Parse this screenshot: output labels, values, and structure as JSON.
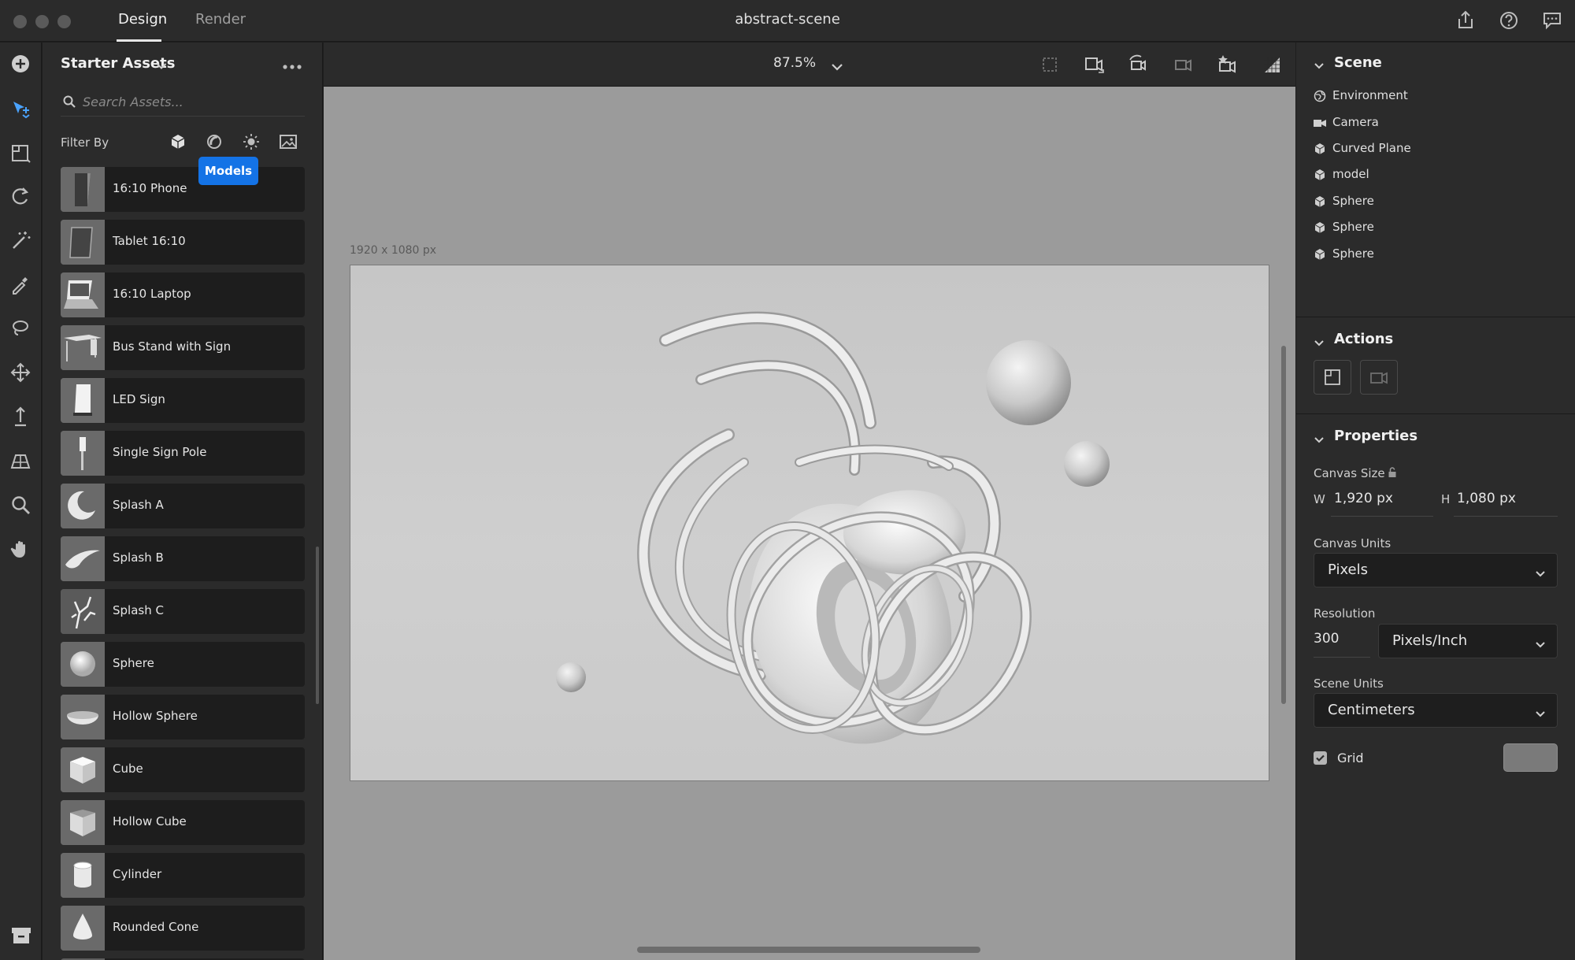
{
  "titlebar": {
    "tabs": [
      {
        "label": "Design"
      },
      {
        "label": "Render"
      }
    ],
    "document_title": "abstract-scene"
  },
  "assets": {
    "title": "Starter Assets",
    "search_placeholder": "Search Assets...",
    "filter_label": "Filter By",
    "tooltip": "Models",
    "items": [
      {
        "label": "16:10 Phone"
      },
      {
        "label": "Tablet 16:10"
      },
      {
        "label": "16:10 Laptop"
      },
      {
        "label": "Bus Stand with Sign"
      },
      {
        "label": "LED Sign"
      },
      {
        "label": "Single Sign Pole"
      },
      {
        "label": "Splash A"
      },
      {
        "label": "Splash B"
      },
      {
        "label": "Splash C"
      },
      {
        "label": "Sphere"
      },
      {
        "label": "Hollow Sphere"
      },
      {
        "label": "Cube"
      },
      {
        "label": "Hollow Cube"
      },
      {
        "label": "Cylinder"
      },
      {
        "label": "Rounded Cone"
      }
    ]
  },
  "viewport": {
    "zoom": "87.5%",
    "canvas_label": "1920 x 1080 px"
  },
  "scene": {
    "title": "Scene",
    "items": [
      {
        "label": "Environment",
        "icon": "environment-icon"
      },
      {
        "label": "Camera",
        "icon": "camera-icon"
      },
      {
        "label": "Curved Plane",
        "icon": "model-icon"
      },
      {
        "label": "model",
        "icon": "model-icon"
      },
      {
        "label": "Sphere",
        "icon": "model-icon"
      },
      {
        "label": "Sphere",
        "icon": "model-icon"
      },
      {
        "label": "Sphere",
        "icon": "model-icon"
      }
    ]
  },
  "actions": {
    "title": "Actions"
  },
  "properties": {
    "title": "Properties",
    "canvas_size_label": "Canvas Size",
    "width_label": "W",
    "width_value": "1,920 px",
    "height_label": "H",
    "height_value": "1,080 px",
    "canvas_units_label": "Canvas Units",
    "canvas_units_value": "Pixels",
    "resolution_label": "Resolution",
    "resolution_value": "300",
    "resolution_unit": "Pixels/Inch",
    "scene_units_label": "Scene Units",
    "scene_units_value": "Centimeters",
    "grid_label": "Grid",
    "grid_checked": true
  },
  "colors": {
    "accent": "#1473e6",
    "panel": "#2b2b2b",
    "canvas": "#cbcbcb"
  }
}
